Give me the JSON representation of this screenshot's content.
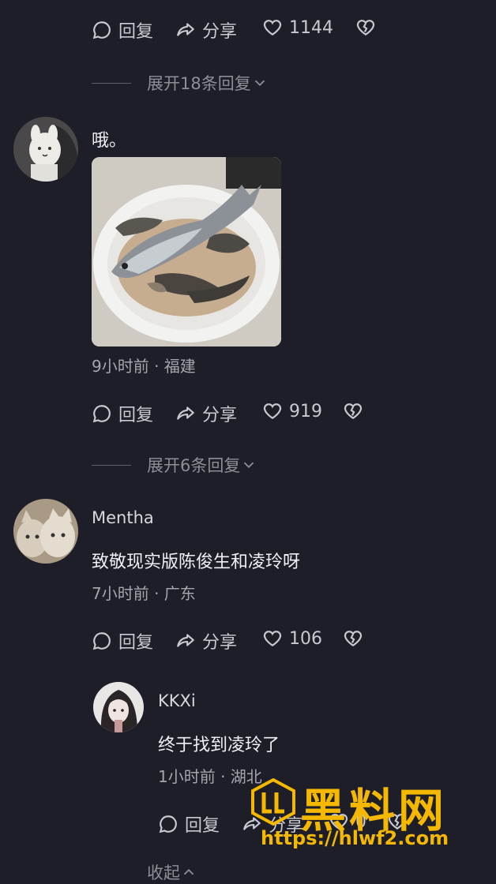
{
  "comment0": {
    "actions": {
      "reply": "回复",
      "share": "分享",
      "likes": "1144"
    },
    "expand": "展开18条回复"
  },
  "comment1": {
    "text": "哦。",
    "meta": "9小时前 · 福建",
    "actions": {
      "reply": "回复",
      "share": "分享",
      "likes": "919"
    },
    "expand": "展开6条回复"
  },
  "comment2": {
    "name": "Mentha",
    "text": "致敬现实版陈俊生和凌玲呀",
    "meta": "7小时前 · 广东",
    "actions": {
      "reply": "回复",
      "share": "分享",
      "likes": "106"
    }
  },
  "reply1": {
    "name": "KKXi",
    "text": "终于找到凌玲了",
    "meta": "1小时前 · 湖北",
    "actions": {
      "reply": "回复",
      "share": "分享",
      "likes": "0"
    }
  },
  "collapse": "收起",
  "watermark": {
    "title": "黑料网",
    "url": "https://hlwf2.com",
    "color": "#f5b800"
  }
}
